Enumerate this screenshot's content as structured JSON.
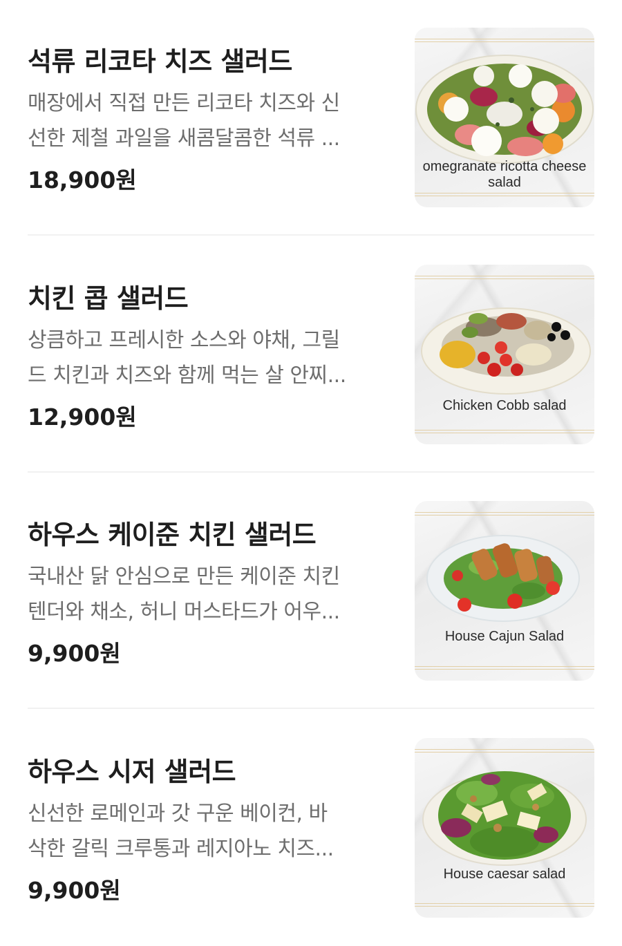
{
  "menu": {
    "items": [
      {
        "name": "석류 리코타 치즈 샐러드",
        "desc_line1": "매장에서 직접 만든 리코타 치즈와 신",
        "desc_line2": "선한 제철 과일을 새콤달콤한 석류 ...",
        "price": "18,900원",
        "image_caption_line1": "omegranate ricotta cheese",
        "image_caption_line2": "salad"
      },
      {
        "name": "치킨 콥 샐러드",
        "desc_line1": "상큼하고 프레시한 소스와 야채, 그릴",
        "desc_line2": "드 치킨과 치즈와 함께 먹는 살 안찌...",
        "price": "12,900원",
        "image_caption_line1": "Chicken Cobb salad"
      },
      {
        "name": "하우스 케이준 치킨 샐러드",
        "desc_line1": "국내산 닭 안심으로 만든 케이준 치킨",
        "desc_line2": "텐더와 채소, 허니 머스타드가 어우...",
        "price": "9,900원",
        "image_caption_line1": "House Cajun Salad"
      },
      {
        "name": "하우스 시저 샐러드",
        "desc_line1": "신선한 로메인과 갓 구운 베이컨, 바",
        "desc_line2": "삭한 갈릭 크루통과 레지아노 치즈...",
        "price": "9,900원",
        "image_caption_line1": "House caesar salad"
      }
    ]
  }
}
